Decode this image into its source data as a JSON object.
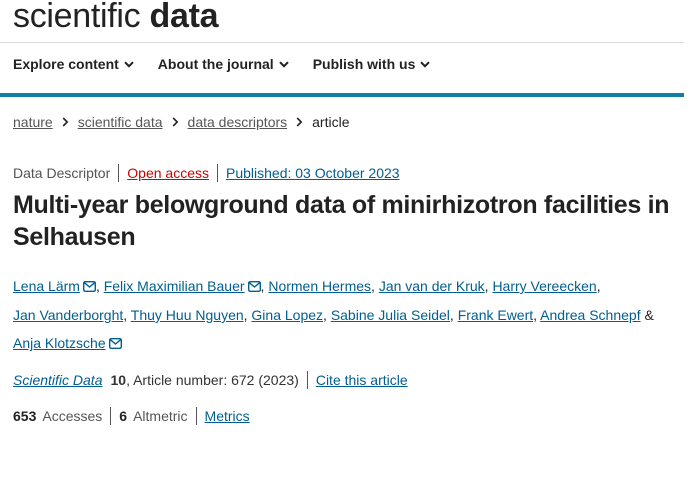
{
  "logo": {
    "light": "scientific",
    "bold": "data"
  },
  "nav": {
    "items": [
      {
        "label": "Explore content"
      },
      {
        "label": "About the journal"
      },
      {
        "label": "Publish with us"
      }
    ]
  },
  "breadcrumb": [
    "nature",
    "scientific data",
    "data descriptors",
    "article"
  ],
  "article_meta": {
    "type": "Data Descriptor",
    "access": "Open access",
    "published": "Published: 03 October 2023"
  },
  "title": "Multi-year belowground data of minirhizotron facilities in Selhausen",
  "authors": [
    "Lena Lärm",
    "Felix Maximilian Bauer",
    "Normen Hermes",
    "Jan van der Kruk",
    "Harry Vereecken",
    "Jan Vanderborght",
    "Thuy Huu Nguyen",
    "Gina Lopez",
    "Sabine Julia Seidel",
    "Frank Ewert",
    "Andrea Schnepf",
    "Anja Klotzsche"
  ],
  "author_separators": {
    "comma": ",",
    "amp": "&"
  },
  "citation": {
    "journal": "Scientific Data",
    "volume": "10",
    "details": ", Article number: 672 (2023)",
    "cite_label": "Cite this article"
  },
  "metrics": {
    "accesses_count": "653",
    "accesses_label": "Accesses",
    "altmetric_count": "6",
    "altmetric_label": "Altmetric",
    "metrics_link": "Metrics"
  },
  "colors": {
    "link": "#025e8d",
    "open_access": "#c40606",
    "accent_rule": "#0f7fa3"
  },
  "icons": {
    "nav_chevron": "chevron-down-icon",
    "crumb_separator": "chevron-right-icon",
    "author_contact": "mail-icon"
  }
}
